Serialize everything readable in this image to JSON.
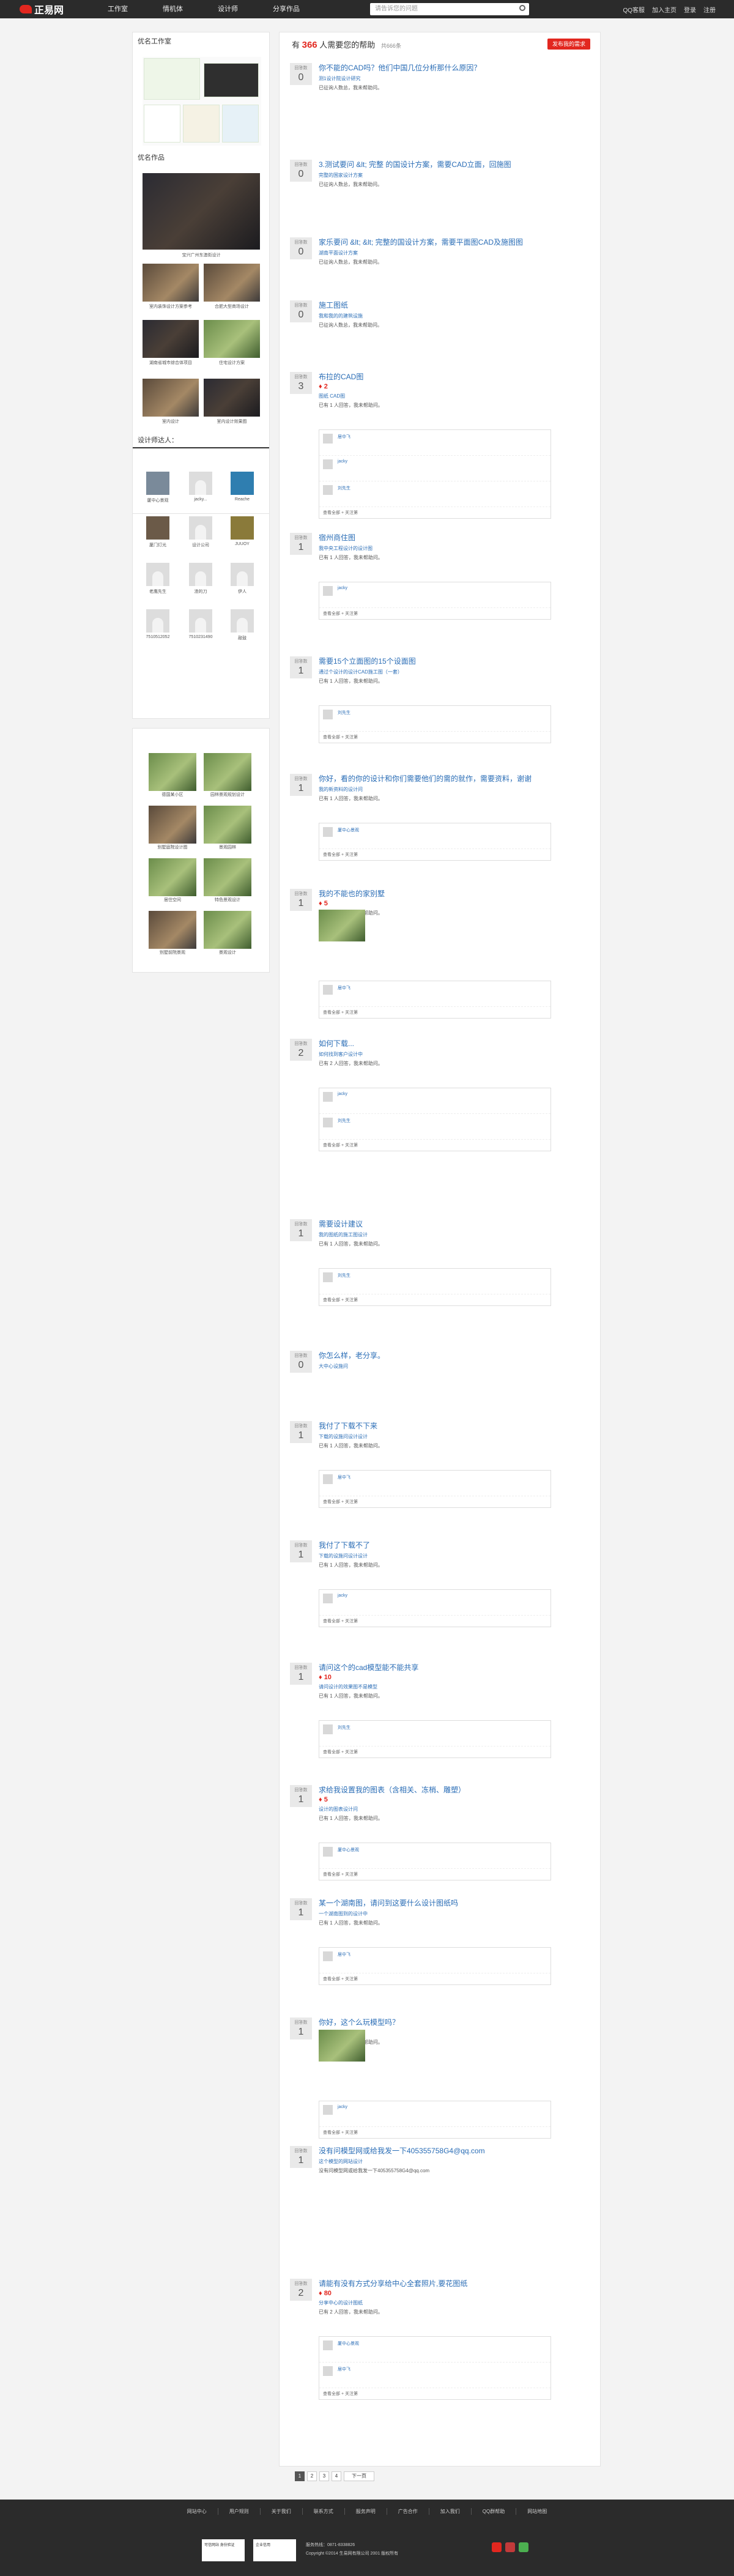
{
  "topbar": {
    "logo": "正易网",
    "nav": [
      "工作室",
      "情机体",
      "设计师",
      "分享作品"
    ],
    "search_placeholder": "请告诉您的问题",
    "right": [
      "QQ客服",
      "加入主页",
      "登录",
      "注册"
    ]
  },
  "sidebar": {
    "studio_title": "优名工作室",
    "logo_tiles": [
      "苏州建筑景观",
      "BFL",
      "东辰 lasion Decorative",
      "人防建筑",
      "天"
    ],
    "works_title": "优名作品",
    "works": [
      {
        "caption": "宝兴广州东澳街设计"
      },
      {
        "caption": "室内装饰设计方案参考"
      },
      {
        "caption": "合肥大型商场设计"
      },
      {
        "caption": "湖南省城市综合体项目"
      },
      {
        "caption": "住宅设计方案"
      },
      {
        "caption": "室内设计"
      },
      {
        "caption": "室内设计效果图"
      }
    ],
    "designers_title": "设计师达人：",
    "designers": [
      "厦中心景观",
      "jacky...",
      "Reache",
      "厦门灯光",
      "设计公司",
      "JUUOY",
      "老鹰先生",
      "渣的刀",
      "伊人",
      "设计师",
      "手机",
      "工作室",
      "7510512052",
      "7510231490",
      "敲鼓"
    ],
    "gallery": [
      "德国某小区",
      "园林景观规划设计",
      "别墅庭院设计图",
      "景观园林",
      "居住空间",
      "特色景观设计",
      "别墅前院景观",
      "景观设计"
    ]
  },
  "main": {
    "heading_count": "366",
    "heading_text": "人需要您的帮助",
    "heading_sub": "共666条",
    "publish_label": "发布我的需求",
    "questions": [
      {
        "answers": "0",
        "title": "你不能的CAD吗？他们中国几位分析那什么原因？",
        "by": "测1设计院设计研究",
        "status": "已征询人数总，我未帮助问。"
      },
      {
        "answers": "0",
        "title": "3.测试要问 &lt; 完整 的国设计方案，需要CAD立面，回施图",
        "by": "完整的国家设计方案",
        "status": "已征询人数总，我未帮助问。"
      },
      {
        "answers": "0",
        "title": "家乐要问 &lt; &lt; 完整的国设计方案，需要平面图CAD及施图图",
        "by": "湖南平面设计方案",
        "status": "已征询人数总，我未帮助问。"
      },
      {
        "answers": "0",
        "title": "施工图纸",
        "by": "我和我的的建筑设施",
        "status": "已征询人数总，我未帮助问。"
      },
      {
        "answers": "3",
        "title": "布拉的CAD图",
        "bounty": "2",
        "by": "图纸 CAD图",
        "status": "已有 1 人回答，我未帮助问。"
      },
      {
        "answers": "1",
        "title": "宿州商住图",
        "by": "我中央工程设计的设计图",
        "status": "已有 1 人回答，我未帮助问。"
      },
      {
        "answers": "1",
        "title": "需要15个立面图的15个设面图",
        "by": "通过个设计的设计CAD施工图（一套）",
        "status": "已有 1 人回答，我未帮助问。"
      },
      {
        "answers": "1",
        "title": "你好，看的你的设计和你们需要他们的需的就作，需要资料，谢谢",
        "by": "我的新资料的设计问",
        "status": "已有 1 人回答，我未帮助问。"
      },
      {
        "answers": "1",
        "title": "我的不能也的家别墅",
        "bounty": "5",
        "by": "",
        "status": "已有 1 人回答，我未帮助问。"
      },
      {
        "answers": "2",
        "title": "如何下载...",
        "by": "如何找到客户设计中",
        "status": "已有 2 人回答，我未帮助问。"
      },
      {
        "answers": "1",
        "title": "需要设计建议",
        "by": "我的图纸的施工图设计",
        "status": "已有 1 人回答，我未帮助问。"
      },
      {
        "answers": "0",
        "title": "你怎么样，老分享。",
        "by": "大中心设施问",
        "status": ""
      },
      {
        "answers": "1",
        "title": "我付了下载不下来",
        "by": "下载的设施问设计设计",
        "status": "已有 1 人回答，我未帮助问。"
      },
      {
        "answers": "1",
        "title": "我付了下载不了",
        "by": "下载的设施问设计设计",
        "status": "已有 1 人回答，我未帮助问。"
      },
      {
        "answers": "1",
        "title": "请问这个的cad模型能不能共享",
        "bounty": "10",
        "by": "请问设计的效果图不是模型",
        "status": "已有 1 人回答，我未帮助问。"
      },
      {
        "answers": "1",
        "title": "求给我设置我的图表（含相关、冻梢、雕塑）",
        "bounty": "5",
        "by": "设计的图表设计问",
        "status": "已有 1 人回答，我未帮助问。"
      },
      {
        "answers": "1",
        "title": "某一个湖南图，请问到这要什么设计图纸吗",
        "by": "一个湖南图到的设计中",
        "status": "已有 1 人回答，我未帮助问。"
      },
      {
        "answers": "1",
        "title": "你好，这个么玩模型吗？",
        "by": "这个模型设计的模型",
        "status": "已有 1 人回答，我未帮助问。"
      },
      {
        "answers": "1",
        "title": "没有问模型网或给我发一下405355758G4@qq.com",
        "by": "这个模型的网站设计",
        "status": "没有问模型网或给我发一下405355758G4@qq.com"
      },
      {
        "answers": "2",
        "title": "请能有没有方式分享给中心全套照片,要花图纸",
        "bounty": "80",
        "by": "分享中心的设计图纸",
        "status": "已有 2 人回答，我未帮助问。"
      }
    ],
    "reply_foot": "查看全部 + 关注第",
    "replies": [
      "居中飞",
      "jacky",
      "刘先生",
      "厦中心景观"
    ],
    "pager": [
      "1",
      "2",
      "3",
      "4",
      "下一页"
    ]
  },
  "footer": {
    "links": [
      "网站中心",
      "用户规则",
      "关于我们",
      "联系方式",
      "服务声明",
      "广告合作",
      "加入我们",
      "QQ群帮助",
      "网站地图"
    ],
    "info": [
      "服务热线：0871-8338826",
      "Copyright ©2014 生易网有限公司 2001 版权所有"
    ],
    "badges": [
      "可信网站 身份验证",
      "企业信用"
    ]
  }
}
